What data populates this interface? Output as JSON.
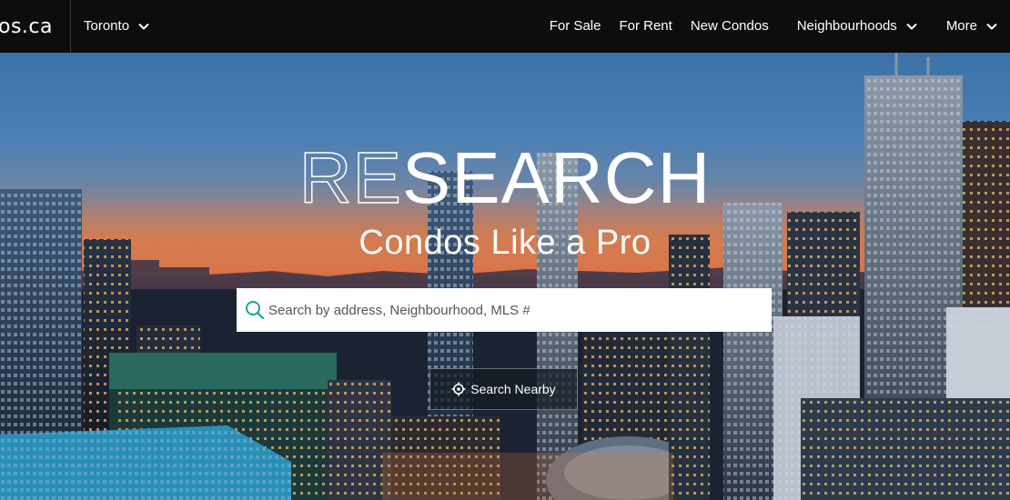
{
  "brand": {
    "logo_text": "os.ca"
  },
  "location": {
    "city": "Toronto"
  },
  "nav": {
    "items": [
      {
        "label": "For Sale"
      },
      {
        "label": "For Rent"
      },
      {
        "label": "New Condos"
      },
      {
        "label": "Neighbourhoods"
      },
      {
        "label": "More"
      }
    ]
  },
  "hero": {
    "headline_outline": "RE",
    "headline_solid": "SEARCH",
    "subheadline": "Condos Like a Pro"
  },
  "search": {
    "placeholder": "Search by address, Neighbourhood, MLS #",
    "value": "",
    "nearby_label": "Search Nearby"
  },
  "icons": {
    "search": "search-icon",
    "nearby": "crosshair-icon",
    "dropdown": "chevron-down-icon"
  },
  "colors": {
    "accent": "#1aa39a",
    "topbar": "#0d0d0d"
  }
}
